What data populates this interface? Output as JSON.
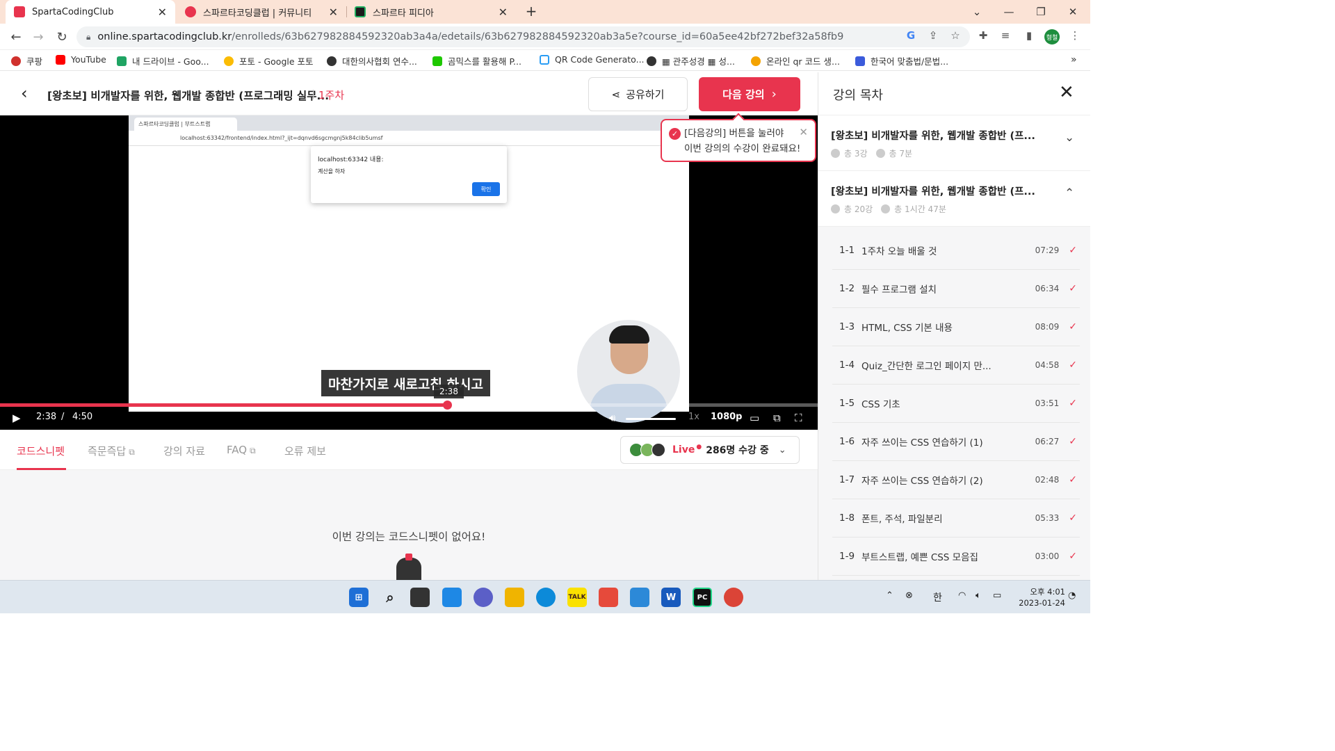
{
  "browser": {
    "tabs": [
      {
        "title": "SpartaCodingClub",
        "close": "✕",
        "color": "#e8344e",
        "icon": "sparta-favicon-icon"
      },
      {
        "title": "스파르타코딩클럽 | 커뮤니티",
        "close": "✕",
        "color": "#e8344e",
        "icon": "heart-favicon-icon"
      },
      {
        "title": "스파르타 피디아",
        "close": "✕",
        "color": "#20b060",
        "icon": "pycharm-favicon-icon"
      }
    ],
    "new_tab": "+",
    "url_host": "online.spartacodingclub.kr",
    "url_path": "/enrolleds/63b627982884592320ab3a4a/edetails/63b627982884592320ab3a5e?course_id=60a5ee42bf272bef32a58fb9",
    "profile_label": "형철",
    "bookmarks": [
      {
        "label": "쿠팡",
        "color": "#d0312d"
      },
      {
        "label": "YouTube",
        "color": "#ff0000"
      },
      {
        "label": "내 드라이브 - Goo...",
        "color": "#1fa463"
      },
      {
        "label": "포토 - Google 포토",
        "color": "#fbbc04"
      },
      {
        "label": "대한의사협회 연수...",
        "color": "#333333"
      },
      {
        "label": "곰믹스를 활용해 P...",
        "color": "#1ec800"
      },
      {
        "label": "QR Code Generato...",
        "color": "#2a9df4"
      },
      {
        "label": "▦ 관주성경 ▦ 성...",
        "color": "#333333"
      },
      {
        "label": "온라인 qr 코드 생...",
        "color": "#f4a300"
      },
      {
        "label": "한국어 맞춤법/문법...",
        "color": "#3b5bdb"
      }
    ],
    "bookmarks_more": "»"
  },
  "header": {
    "back": "‹",
    "title": "[왕초보] 비개발자를 위한, 웹개발 종합반 (프로그래밍 실무...",
    "week": "1주차",
    "share_label": "공유하기",
    "next_label": "다음 강의",
    "next_chevron": "›"
  },
  "notice": {
    "line1": "[다음강의] 버튼을 눌러야",
    "line2": "이번 강의의 수강이 완료돼요!",
    "close": "✕"
  },
  "video": {
    "inner_tab": "스파르타코딩클럽 | 부트스트랩",
    "inner_url": "localhost:63342/frontend/index.html?_ijt=dqnvd6sgcmgnj5k84clib5umsf",
    "dialog_title": "localhost:63342 내용:",
    "dialog_text": "계산을 하자",
    "dialog_ok": "확인",
    "subtitle": "마찬가지로 새로고침 하시고",
    "hover_time": "2:38",
    "current_time": "2:38",
    "separator": "/",
    "duration": "4:50",
    "progress": 0.547,
    "volume": 1.0,
    "speed": "1x",
    "quality": "1080p"
  },
  "content_tabs": {
    "tabs": [
      {
        "label": "코드스니펫",
        "active": true,
        "external": false
      },
      {
        "label": "즉문즉답",
        "active": false,
        "external": true
      },
      {
        "label": "강의 자료",
        "active": false,
        "external": false
      },
      {
        "label": "FAQ",
        "active": false,
        "external": true
      },
      {
        "label": "오류 제보",
        "active": false,
        "external": false
      }
    ],
    "live_label": "Live",
    "live_count": "286명 수강 중"
  },
  "content": {
    "empty_message": "이번 강의는 코드스니펫이 없어요!"
  },
  "sidebar": {
    "title": "강의 목차",
    "close": "✕",
    "sections": [
      {
        "title": "[왕초보] 비개발자를 위한, 웹개발 종합반 (프...",
        "count": "총 3강",
        "time": "총 7분",
        "expanded": false
      },
      {
        "title": "[왕초보] 비개발자를 위한, 웹개발 종합반 (프...",
        "count": "총 20강",
        "time": "총 1시간 47분",
        "expanded": true
      }
    ],
    "lectures": [
      {
        "no": "1-1",
        "name": "1주차 오늘 배울 것",
        "duration": "07:29"
      },
      {
        "no": "1-2",
        "name": "필수 프로그램 설치",
        "duration": "06:34"
      },
      {
        "no": "1-3",
        "name": "HTML, CSS 기본 내용",
        "duration": "08:09"
      },
      {
        "no": "1-4",
        "name": "Quiz_간단한 로그인 페이지 만...",
        "duration": "04:58"
      },
      {
        "no": "1-5",
        "name": "CSS 기초",
        "duration": "03:51"
      },
      {
        "no": "1-6",
        "name": "자주 쓰이는 CSS 연습하기 (1)",
        "duration": "06:27"
      },
      {
        "no": "1-7",
        "name": "자주 쓰이는 CSS 연습하기 (2)",
        "duration": "02:48"
      },
      {
        "no": "1-8",
        "name": "폰트, 주석, 파일분리",
        "duration": "05:33"
      },
      {
        "no": "1-9",
        "name": "부트스트랩, 예쁜 CSS 모음집",
        "duration": "03:00"
      }
    ]
  },
  "taskbar": {
    "ime": "한",
    "time": "오후 4:01",
    "date": "2023-01-24",
    "kakao_label": "TALK"
  },
  "colors": {
    "accent": "#e8344e",
    "tabbar": "#fbe3d6"
  }
}
